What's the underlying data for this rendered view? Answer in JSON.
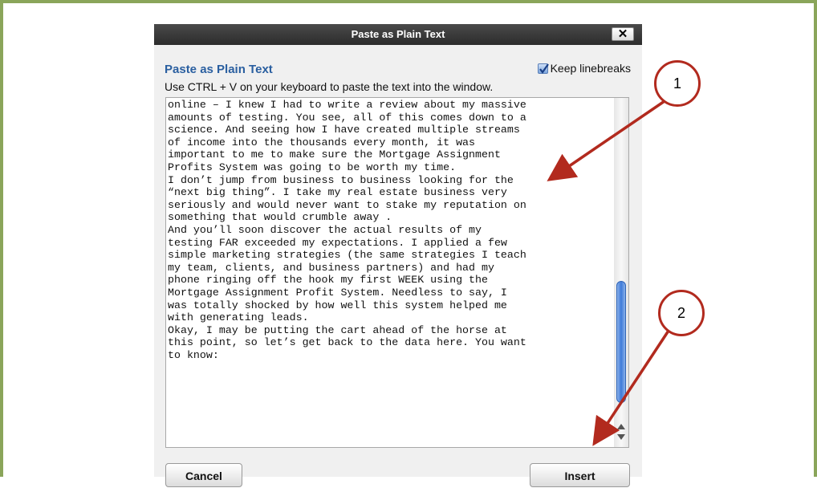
{
  "dialog": {
    "title": "Paste as Plain Text",
    "close_label": "✕",
    "heading": "Paste as Plain Text",
    "keep_linebreaks_label": "Keep linebreaks",
    "keep_linebreaks_checked": true,
    "instructions": "Use CTRL + V on your keyboard to paste the text into the window.",
    "text_lines": [
      "online – I knew I had to write a review about my massive",
      "amounts of testing. You see, all of this comes down to a",
      "science. And seeing how I have created multiple streams",
      "of income into the thousands every month, it was",
      "important to me to make sure the Mortgage Assignment",
      "Profits System was going to be worth my time.",
      "I don’t jump from business to business looking for the",
      "“next big thing”. I take my real estate business very",
      "seriously and would never want to stake my reputation on",
      "something that would crumble away .",
      "And you’ll soon discover the actual results of my",
      "testing FAR exceeded my expectations. I applied a few",
      "simple marketing strategies (the same strategies I teach",
      "my team, clients, and business partners) and had my",
      "phone ringing off the hook my first WEEK using the",
      "Mortgage Assignment Profit System. Needless to say, I",
      "was totally shocked by how well this system helped me",
      "with generating leads.",
      "Okay, I may be putting the cart ahead of the horse at",
      "this point, so let’s get back to the data here. You want",
      "to know:"
    ],
    "cancel_label": "Cancel",
    "insert_label": "Insert"
  },
  "callouts": [
    "1",
    "2"
  ],
  "colors": {
    "frame_border": "#8aa55a",
    "heading": "#2a5fa0",
    "callout_red": "#b22a1e",
    "scroll_thumb": "#3e7ad9"
  },
  "icons": [
    "close-icon",
    "checkmark-icon",
    "scroll-up-arrow-icon",
    "scroll-down-arrow-icon"
  ]
}
